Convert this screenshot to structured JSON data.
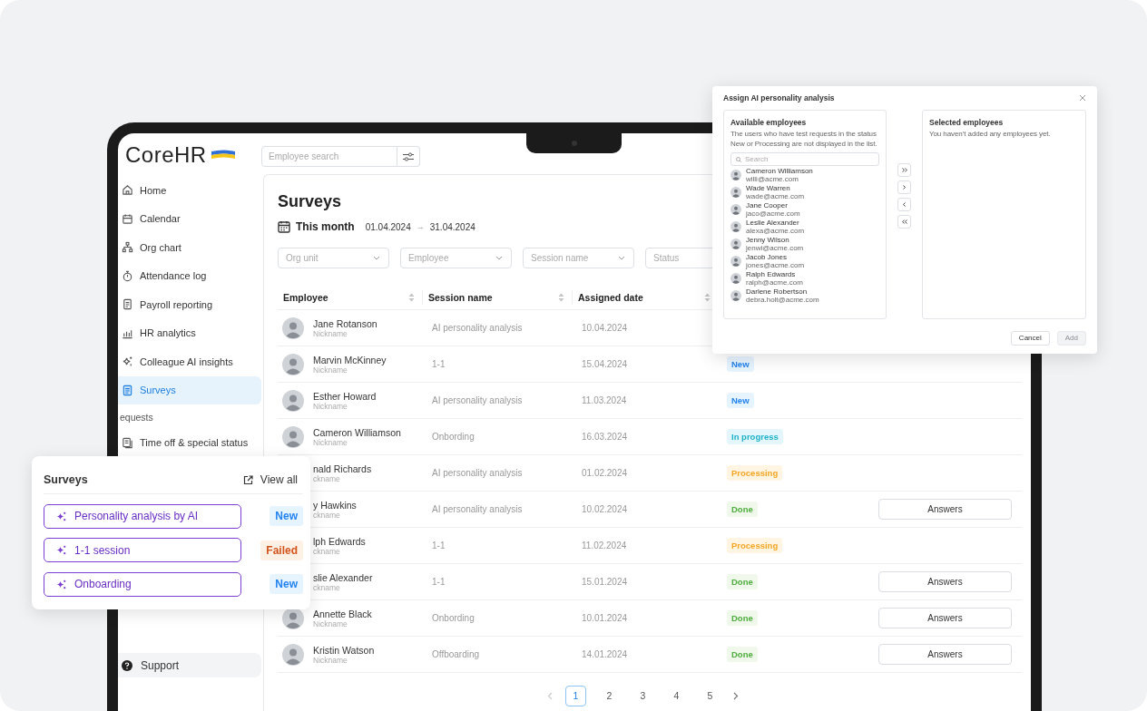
{
  "sidebar": {
    "logo": "CoreHR",
    "items": [
      {
        "label": "Home",
        "selected": false
      },
      {
        "label": "Calendar",
        "selected": false
      },
      {
        "label": "Org chart",
        "selected": false
      },
      {
        "label": "Attendance log",
        "selected": false
      },
      {
        "label": "Payroll reporting",
        "selected": false
      },
      {
        "label": "HR analytics",
        "selected": false
      },
      {
        "label": "Colleague AI insights",
        "selected": false
      },
      {
        "label": "Surveys",
        "selected": true
      }
    ],
    "section_label": "equests",
    "section_items": [
      {
        "label": "Time off & special status",
        "selected": false
      }
    ],
    "support": "Support"
  },
  "search": {
    "placeholder": "Employee search"
  },
  "page_title": "Surveys",
  "period": {
    "label": "This month",
    "start": "01.04.2024",
    "arrow": "→",
    "end": "31.04.2024"
  },
  "filters": [
    {
      "placeholder": "Org unit"
    },
    {
      "placeholder": "Employee"
    },
    {
      "placeholder": "Session name"
    },
    {
      "placeholder": "Status"
    }
  ],
  "table": {
    "columns": [
      "Employee",
      "Session name",
      "Assigned date"
    ],
    "rows": [
      {
        "avatar": true,
        "name": "Jane Rotanson",
        "nickname": "Nickname",
        "session": "AI personality analysis",
        "date": "10.04.2024"
      },
      {
        "avatar": true,
        "name": "Marvin McKinney",
        "nickname": "Nickname",
        "session": "1-1",
        "date": "15.04.2024",
        "status": {
          "label": "New",
          "kind": "new"
        }
      },
      {
        "avatar": true,
        "name": "Esther Howard",
        "nickname": "Nickname",
        "session": "AI personality analysis",
        "date": "11.03.2024",
        "status": {
          "label": "New",
          "kind": "new"
        }
      },
      {
        "avatar": true,
        "name": "Cameron Williamson",
        "nickname": "Nickname",
        "session": "Onbording",
        "date": "16.03.2024",
        "status": {
          "label": "In progress",
          "kind": "progress"
        }
      },
      {
        "avatar": false,
        "name": "nald Richards",
        "nickname": "ckname",
        "session": "AI personality analysis",
        "date": "01.02.2024",
        "status": {
          "label": "Processing",
          "kind": "processing"
        }
      },
      {
        "avatar": false,
        "name": "y Hawkins",
        "nickname": "ckname",
        "session": "AI personality analysis",
        "date": "10.02.2024",
        "status": {
          "label": "Done",
          "kind": "done"
        },
        "action": "Answers"
      },
      {
        "avatar": false,
        "name": "lph Edwards",
        "nickname": "ckname",
        "session": "1-1",
        "date": "11.02.2024",
        "status": {
          "label": "Processing",
          "kind": "processing"
        }
      },
      {
        "avatar": false,
        "name": "slie Alexander",
        "nickname": "ckname",
        "session": "1-1",
        "date": "15.01.2024",
        "status": {
          "label": "Done",
          "kind": "done"
        },
        "action": "Answers"
      },
      {
        "avatar": true,
        "name": "Annette Black",
        "nickname": "Nickname",
        "session": "Onbording",
        "date": "10.01.2024",
        "status": {
          "label": "Done",
          "kind": "done"
        },
        "action": "Answers"
      },
      {
        "avatar": true,
        "name": "Kristin Watson",
        "nickname": "Nickname",
        "session": "Offboarding",
        "date": "14.01.2024",
        "status": {
          "label": "Done",
          "kind": "done"
        },
        "action": "Answers"
      }
    ]
  },
  "pagination": {
    "pages": [
      {
        "label": "1",
        "selected": true
      },
      {
        "label": "2",
        "selected": false
      },
      {
        "label": "3",
        "selected": false
      },
      {
        "label": "4",
        "selected": false
      },
      {
        "label": "5",
        "selected": false
      }
    ]
  },
  "popover": {
    "title": "Surveys",
    "view_all": "View all",
    "items": [
      {
        "label": "Personality analysis by AI",
        "status": {
          "label": "New",
          "kind": "new"
        }
      },
      {
        "label": "1-1 session",
        "status": {
          "label": "Failed",
          "kind": "failed"
        }
      },
      {
        "label": "Onboarding",
        "status": {
          "label": "New",
          "kind": "new"
        }
      }
    ]
  },
  "modal": {
    "title": "Assign AI personality analysis",
    "available": {
      "title": "Available employees",
      "note": "The users who have test requests in the status New or Processing are not displayed in the list.",
      "search_placeholder": "Search",
      "employees": [
        {
          "name": "Cameron Williamson",
          "email": "willi@acme.com"
        },
        {
          "name": "Wade Warren",
          "email": "wade@acme.com"
        },
        {
          "name": "Jane Cooper",
          "email": "jaco@acme.com"
        },
        {
          "name": "Leslie Alexander",
          "email": "alexa@acme.com"
        },
        {
          "name": "Jenny Wilson",
          "email": "jenwi@acme.com"
        },
        {
          "name": "Jacob Jones",
          "email": "jones@acme.com"
        },
        {
          "name": "Ralph Edwards",
          "email": "ralph@acme.com"
        },
        {
          "name": "Darlene Robertson",
          "email": "debra.holt@acme.com"
        }
      ]
    },
    "selected": {
      "title": "Selected employees",
      "empty": "You haven’t added any employees yet."
    },
    "buttons": [
      {
        "label": "Cancel",
        "disabled": false
      },
      {
        "label": "Add",
        "disabled": true
      }
    ]
  }
}
